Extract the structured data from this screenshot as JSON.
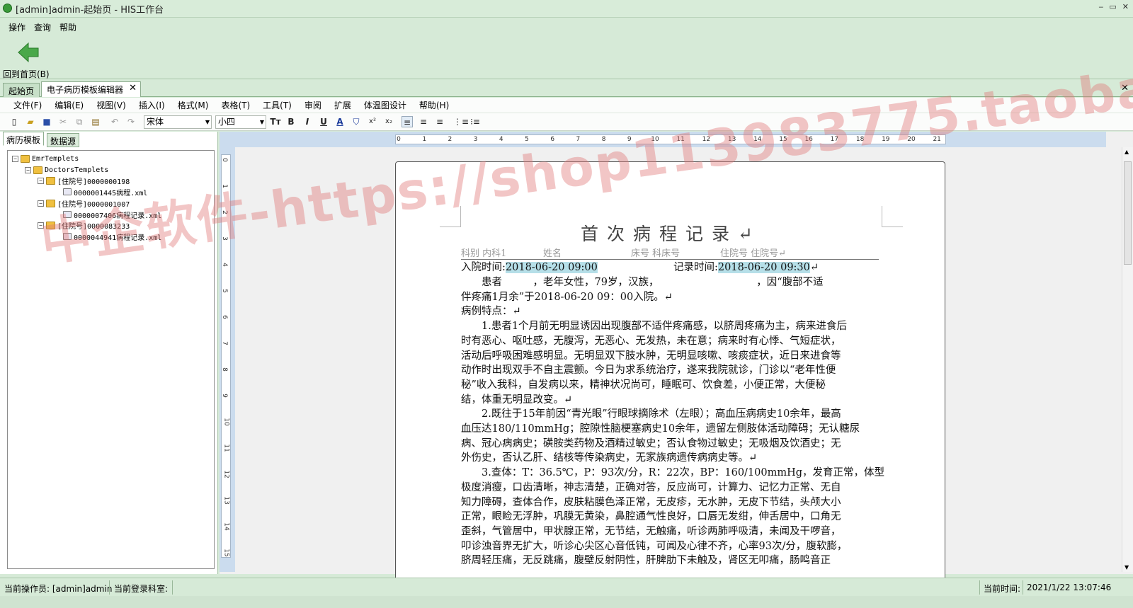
{
  "window": {
    "title": "[admin]admin-起始页 - HIS工作台",
    "controls": [
      "‒",
      "▭",
      "✕"
    ]
  },
  "menu": [
    "操作",
    "查询",
    "帮助"
  ],
  "toolbar": {
    "back_label": "回到首页(B)"
  },
  "tabs": [
    {
      "label": "起始页"
    },
    {
      "label": "电子病历模板编辑器"
    }
  ],
  "editor_menu": [
    "文件(F)",
    "编辑(E)",
    "视图(V)",
    "插入(I)",
    "格式(M)",
    "表格(T)",
    "工具(T)",
    "审阅",
    "扩展",
    "体温图设计",
    "帮助(H)"
  ],
  "format": {
    "font": "宋体",
    "size": "小四"
  },
  "left_tabs": [
    "病历模板",
    "数据源"
  ],
  "tree": [
    {
      "label": "EmrTemplets"
    },
    {
      "label": "DoctorsTemplets"
    },
    {
      "label": "[住院号]0000000198"
    },
    {
      "label": "0000001445病程.xml"
    },
    {
      "label": "[住院号]0000001007"
    },
    {
      "label": "0000007406病程记录.xml"
    },
    {
      "label": "[住院号]0000083233"
    },
    {
      "label": "0000044941病程记录.xml"
    }
  ],
  "ruler_top": [
    "0",
    "1",
    "2",
    "3",
    "4",
    "5",
    "6",
    "7",
    "8",
    "9",
    "10",
    "11",
    "12",
    "13",
    "14",
    "15",
    "16",
    "17",
    "18",
    "19",
    "20",
    "21"
  ],
  "ruler_left": [
    "0",
    "1",
    "2",
    "3",
    "4",
    "5",
    "6",
    "7",
    "8",
    "9",
    "10",
    "11",
    "12",
    "13",
    "14",
    "15"
  ],
  "document": {
    "title": "首次病程记录↵",
    "meta": {
      "dept": "科别 内科1",
      "name": "姓名",
      "bed": "床号 科床号",
      "inpatient": "住院号 住院号↵"
    },
    "admit_label": "入院时间:",
    "admit_time": "2018-06-20 09:00",
    "record_label": "记录时间:",
    "record_time": "2018-06-20 09:30",
    "lines": [
      "　　患者　　　，老年女性，79岁，汉族，　　　　　　　　　　，因“腹部不适",
      "伴疼痛1月余”于2018-06-20 09：00入院。↵",
      "病例特点：↵",
      "　　1.患者1个月前无明显诱因出现腹部不适伴疼痛感，以脐周疼痛为主，病来进食后",
      "时有恶心、呕吐感，无腹泻，无恶心、无发热，未在意；病来时有心悸、气短症状，",
      "活动后呼吸困难感明显。无明显双下肢水肿，无明显咳嗽、咳痰症状，近日来进食等",
      "动作时出现双手不自主震颤。今日为求系统治疗，遂来我院就诊，门诊以“老年性便",
      "秘”收入我科，自发病以来，精神状况尚可，睡眠可、饮食差，小便正常，大便秘",
      "结，体重无明显改变。↵",
      "　　2.既往于15年前因“青光眼”行眼球摘除术（左眼）；高血压病病史10余年，最高",
      "血压达180/110mmHg；腔隙性脑梗塞病史10余年，遗留左侧肢体活动障碍；无认糖尿",
      "病、冠心病病史；磺胺类药物及酒精过敏史；否认食物过敏史；无吸烟及饮酒史；无",
      "外伤史，否认乙肝、结核等传染病史，无家族病遗传病病史等。↵",
      "　　3.查体：T：36.5℃，P：93次/分，R：22次，BP：160/100mmHg，发育正常，体型",
      "极度消瘦，口齿清晰，神志清楚，正确对答，反应尚可，计算力、记忆力正常、无自",
      "知力障碍，查体合作，皮肤粘膜色泽正常，无皮疹，无水肿，无皮下节结，头颅大小",
      "正常，眼睑无浮肿，巩膜无黄染，鼻腔通气性良好，口唇无发绀，伸舌居中，口角无",
      "歪斜，气管居中，甲状腺正常，无节结，无触痛，听诊两肺呼吸清，未闻及干啰音，",
      "叩诊浊音界无扩大，听诊心尖区心音低钝，可闻及心律不齐，心率93次/分，腹软膨，",
      "脐周轻压痛，无反跳痛，腹壁反射阴性，肝脾肋下未触及，肾区无叩痛，肠鸣音正"
    ]
  },
  "watermark": "中企软件-https://shop113983775.taobao.com",
  "status": {
    "operator": "当前操作员: [admin]admin",
    "dept": "当前登录科室:",
    "time_label": "当前时间:",
    "time": "2021/1/22 13:07:46"
  }
}
